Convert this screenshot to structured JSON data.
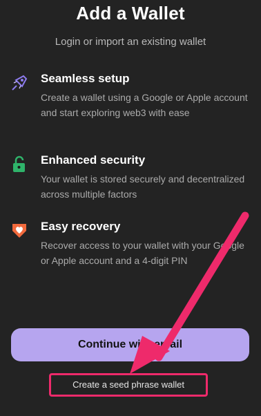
{
  "header": {
    "title": "Add a Wallet",
    "subtitle": "Login or import an existing wallet"
  },
  "features": [
    {
      "icon": "rocket-icon",
      "title": "Seamless setup",
      "description": "Create a wallet using a Google or Apple account and start exploring web3 with ease"
    },
    {
      "icon": "lock-icon",
      "title": "Enhanced security",
      "description": "Your wallet is stored securely and decentralized across multiple factors"
    },
    {
      "icon": "heart-badge-icon",
      "title": "Easy recovery",
      "description": "Recover access to your wallet with your Google or Apple account and a 4-digit PIN"
    }
  ],
  "actions": {
    "continue_label": "Continue with email",
    "seed_label": "Create a seed phrase wallet"
  },
  "colors": {
    "background": "#232323",
    "button": "#b6a5ef",
    "highlight": "#ee2a6b",
    "lock_green": "#2fb36a",
    "recovery_orange": "#f26a3d",
    "rocket_purple": "#8e7cf0"
  }
}
